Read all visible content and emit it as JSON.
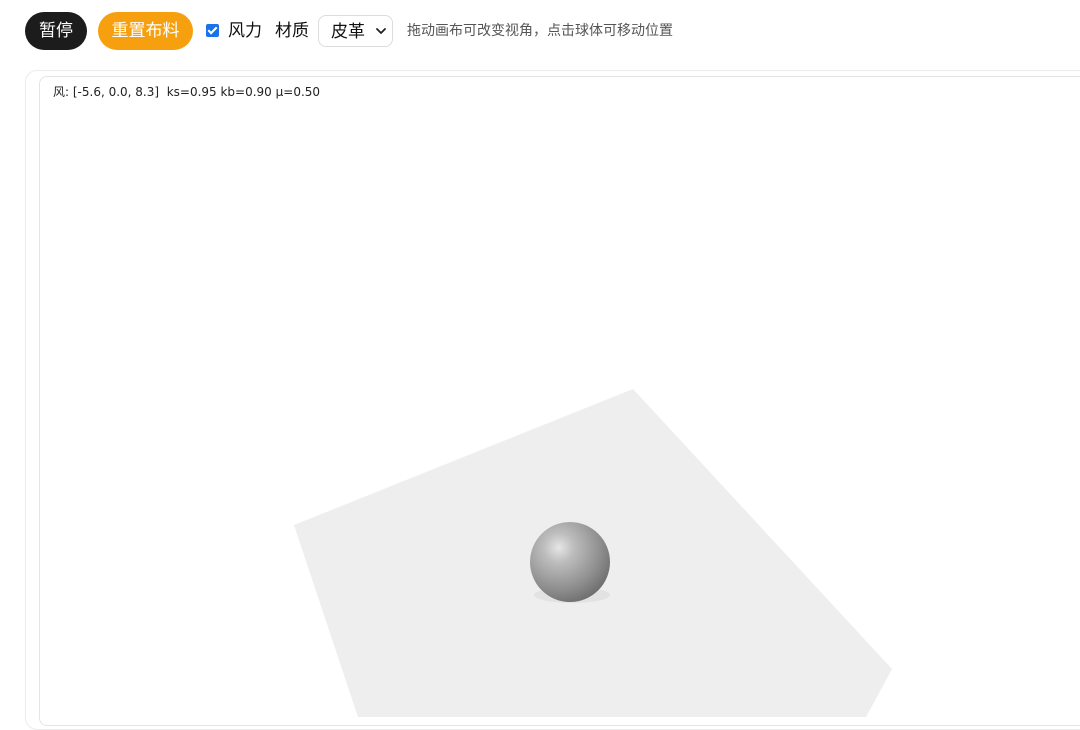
{
  "toolbar": {
    "pause_label": "暂停",
    "reset_label": "重置布料",
    "wind_checked": true,
    "wind_label": "风力",
    "material_label": "材质",
    "material_selected": "皮革",
    "hint": "拖动画布可改变视角，点击球体可移动位置",
    "colors": {
      "pause_bg": "#1c1c1c",
      "reset_bg": "#f7a00f",
      "checkbox": "#1a73e8"
    }
  },
  "viewport": {
    "status": "风: [-5.6, 0.0, 8.3]  ks=0.95 kb=0.90 μ=0.50",
    "cloth_color": "#eeeeee",
    "sphere_color": "#8e8e8e"
  }
}
